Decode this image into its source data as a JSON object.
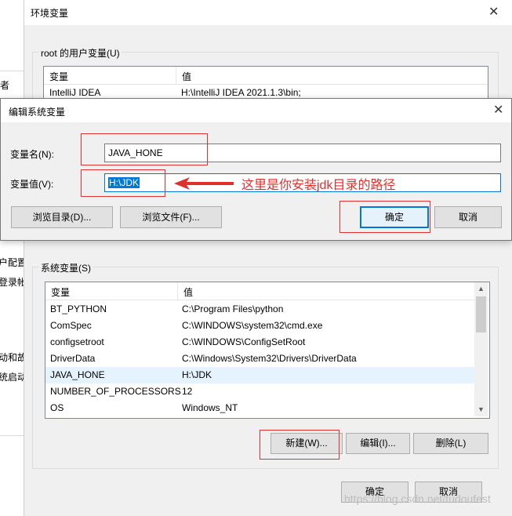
{
  "background_window": {
    "fragments": [
      "者",
      "户配置",
      "登录帐",
      "动和故",
      "统启动"
    ]
  },
  "env_window": {
    "title": "环境变量",
    "user_vars": {
      "label": "root 的用户变量(U)",
      "columns": [
        "变量",
        "值"
      ],
      "rows": [
        {
          "name": "IntelliJ IDEA",
          "value": "H:\\IntelliJ IDEA 2021.1.3\\bin;"
        }
      ]
    },
    "system_vars": {
      "label": "系统变量(S)",
      "columns": [
        "变量",
        "值"
      ],
      "rows": [
        {
          "name": "BT_PYTHON",
          "value": "C:\\Program Files\\python"
        },
        {
          "name": "ComSpec",
          "value": "C:\\WINDOWS\\system32\\cmd.exe"
        },
        {
          "name": "configsetroot",
          "value": "C:\\WINDOWS\\ConfigSetRoot"
        },
        {
          "name": "DriverData",
          "value": "C:\\Windows\\System32\\Drivers\\DriverData"
        },
        {
          "name": "JAVA_HONE",
          "value": "H:\\JDK"
        },
        {
          "name": "NUMBER_OF_PROCESSORS",
          "value": "12"
        },
        {
          "name": "OS",
          "value": "Windows_NT"
        }
      ],
      "buttons": {
        "new": "新建(W)...",
        "edit": "编辑(I)...",
        "delete": "删除(L)"
      }
    },
    "ok": "确定",
    "cancel": "取消"
  },
  "edit_dialog": {
    "title": "编辑系统变量",
    "name_label": "变量名(N):",
    "name_value": "JAVA_HONE",
    "value_label": "变量值(V):",
    "value_value": "H:\\JDK",
    "browse_dir": "浏览目录(D)...",
    "browse_file": "浏览文件(F)...",
    "ok": "确定",
    "cancel": "取消"
  },
  "annotation": "这里是你安装jdk目录的路径",
  "watermark": "https://blog.csdn.net/tudoufest",
  "colors": {
    "annotation_red": "#e0302e",
    "selection_blue": "#0078d7",
    "row_highlight": "#e5f3ff"
  },
  "icons": {
    "close": "close-icon",
    "arrow": "left-arrow-icon",
    "scroll_up": "scroll-up-arrow-icon",
    "scroll_down": "scroll-down-arrow-icon"
  }
}
